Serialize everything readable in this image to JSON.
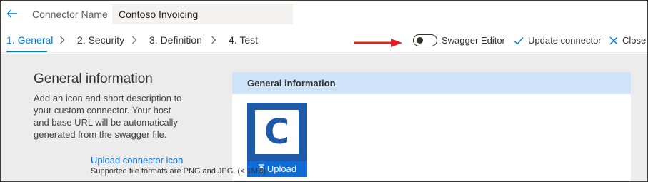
{
  "header": {
    "connector_name_label": "Connector Name",
    "connector_name_value": "Contoso Invoicing"
  },
  "steps": [
    {
      "label": "1. General",
      "active": true
    },
    {
      "label": "2. Security",
      "active": false
    },
    {
      "label": "3. Definition",
      "active": false
    },
    {
      "label": "4. Test",
      "active": false
    }
  ],
  "toolbar": {
    "swagger_editor_label": "Swagger Editor",
    "swagger_editor_on": false,
    "update_label": "Update connector",
    "close_label": "Close"
  },
  "general": {
    "title": "General information",
    "description": "Add an icon and short description to your custom connector. Your host and base URL will be automatically generated from the swagger file."
  },
  "panel": {
    "header": "General information",
    "icon_letter": "C",
    "upload_button": "Upload",
    "upload_link": "Upload connector icon",
    "upload_note": "Supported file formats are PNG and JPG. (< 1MB)"
  },
  "colors": {
    "accent": "#0078d4",
    "icon_background": "#1e5aa8",
    "panel_header": "#cfe4fa",
    "annotation_arrow": "#e02020"
  },
  "icons": [
    "back-arrow-icon",
    "chevron-right-icon",
    "annotation-arrow-icon",
    "toggle-switch",
    "checkmark-icon",
    "close-icon",
    "upload-icon"
  ]
}
